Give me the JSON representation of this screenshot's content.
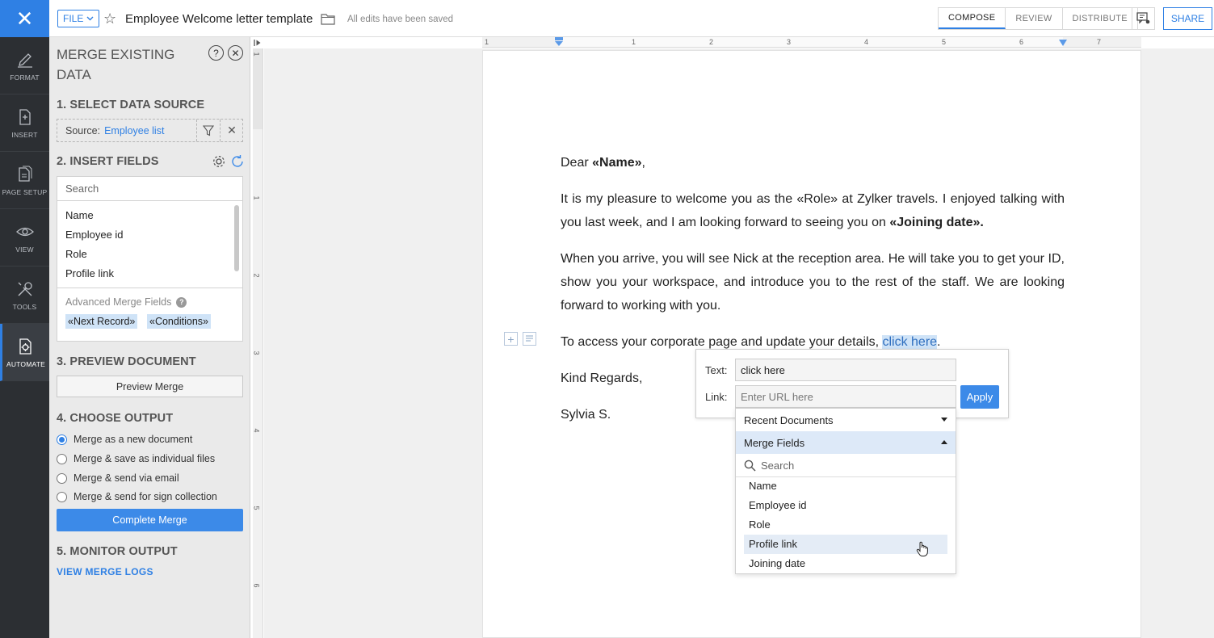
{
  "topbar": {
    "close_glyph": "✕",
    "file_label": "FILE",
    "title": "Employee Welcome letter template",
    "save_status": "All edits have been saved",
    "tabs": [
      {
        "label": "COMPOSE",
        "active": true
      },
      {
        "label": "REVIEW",
        "active": false
      },
      {
        "label": "DISTRIBUTE",
        "active": false
      }
    ],
    "share_label": "SHARE"
  },
  "rail": {
    "items": [
      {
        "label": "FORMAT",
        "icon": "format-pen-icon"
      },
      {
        "label": "INSERT",
        "icon": "insert-doc-icon"
      },
      {
        "label": "PAGE SETUP",
        "icon": "page-setup-icon"
      },
      {
        "label": "VIEW",
        "icon": "eye-icon"
      },
      {
        "label": "TOOLS",
        "icon": "tools-icon"
      },
      {
        "label": "AUTOMATE",
        "icon": "automate-gear-icon",
        "active": true
      }
    ]
  },
  "panel": {
    "title": "MERGE EXISTING DATA",
    "steps": {
      "select_source": "1. SELECT DATA SOURCE",
      "insert_fields": "2. INSERT FIELDS",
      "preview": "3. PREVIEW DOCUMENT",
      "output": "4. CHOOSE OUTPUT",
      "monitor": "5. MONITOR OUTPUT"
    },
    "source_label": "Source:",
    "source_value": "Employee list",
    "fields_search_placeholder": "Search",
    "fields": [
      "Name",
      "Employee id",
      "Role",
      "Profile link"
    ],
    "advanced_label": "Advanced Merge Fields",
    "advanced_tags": [
      "«Next Record»",
      "«Conditions»"
    ],
    "preview_button": "Preview Merge",
    "output_options": [
      {
        "label": "Merge as a new document",
        "checked": true
      },
      {
        "label": "Merge & save as individual files",
        "checked": false
      },
      {
        "label": "Merge & send via email",
        "checked": false
      },
      {
        "label": "Merge & send for sign collection",
        "checked": false
      }
    ],
    "complete_button": "Complete Merge",
    "merge_logs_link": "VIEW MERGE LOGS"
  },
  "ruler": {
    "h_labels": [
      "1",
      "1",
      "2",
      "3",
      "4",
      "5",
      "6",
      "7"
    ],
    "v_labels": [
      "1",
      "1",
      "2",
      "3",
      "4",
      "5",
      "6"
    ]
  },
  "document": {
    "greeting_prefix": "Dear ",
    "greeting_field": "«Name»",
    "greeting_suffix": ",",
    "p1_a": "It is my pleasure to welcome you as the «Role» at Zylker travels. I enjoyed talking with you last week, and I am looking forward to seeing you on ",
    "p1_field": "«Joining date».",
    "p2": "When you arrive, you will see Nick at the reception area. He will take you to get your ID, show you your workspace, and introduce you to the rest of the staff. We are looking forward to working with you.",
    "p3_a": "To access your corporate page and update your details, ",
    "p3_link": "click here",
    "p3_b": ".",
    "closing": "Kind Regards,",
    "signature": "Sylvia S."
  },
  "link_popup": {
    "text_label": "Text:",
    "text_value": "click here",
    "link_label": "Link:",
    "link_placeholder": "Enter URL here",
    "apply_label": "Apply"
  },
  "link_dropdown": {
    "recent_label": "Recent Documents",
    "merge_label": "Merge Fields",
    "search_placeholder": "Search",
    "items": [
      "Name",
      "Employee id",
      "Role",
      "Profile link",
      "Joining date"
    ],
    "hover_index": 3
  },
  "colors": {
    "accent": "#2f80e4",
    "rail_bg": "#2c2f33",
    "panel_bg": "#eaeaea",
    "highlight": "#cfe3f7"
  }
}
